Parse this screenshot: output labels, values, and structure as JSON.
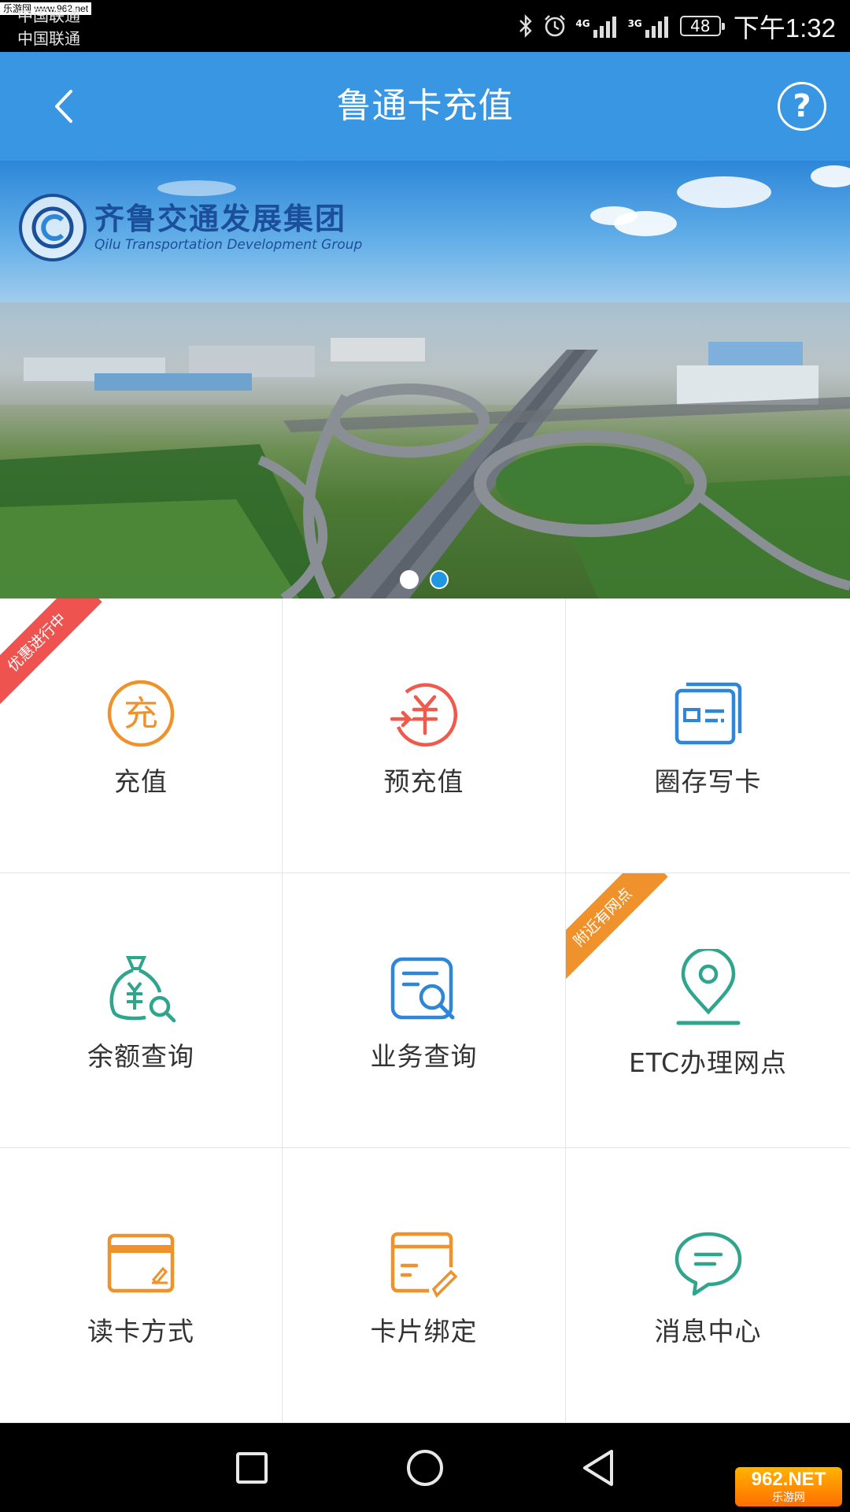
{
  "status_bar": {
    "watermark_top": "乐游网 www.962.net",
    "carrier_1": "中国联通",
    "carrier_2": "中国联通",
    "net_1": "4G",
    "net_2": "3G",
    "battery": "48",
    "time": "下午1:32"
  },
  "app_bar": {
    "title": "鲁通卡充值",
    "help_label": "?"
  },
  "banner": {
    "logo_cn": "齐鲁交通发展集团",
    "logo_en": "Qilu Transportation Development Group",
    "page_count": 2,
    "active_page": 2
  },
  "grid": [
    {
      "label": "充值",
      "icon": "recharge-icon",
      "color": "#f0922b",
      "ribbon": "优惠进行中",
      "ribbon_color": "#ef5350"
    },
    {
      "label": "预充值",
      "icon": "prepaid-icon",
      "color": "#ef5a4c"
    },
    {
      "label": "圈存写卡",
      "icon": "card-write-icon",
      "color": "#2f86d6"
    },
    {
      "label": "余额查询",
      "icon": "balance-query-icon",
      "color": "#2ea58c"
    },
    {
      "label": "业务查询",
      "icon": "business-query-icon",
      "color": "#2f86d6"
    },
    {
      "label": "ETC办理网点",
      "icon": "location-pin-icon",
      "color": "#2ea58c",
      "ribbon": "附近有网点",
      "ribbon_color": "#f0922b"
    },
    {
      "label": "读卡方式",
      "icon": "card-reader-icon",
      "color": "#f0922b"
    },
    {
      "label": "卡片绑定",
      "icon": "card-bind-icon",
      "color": "#f0922b"
    },
    {
      "label": "消息中心",
      "icon": "message-icon",
      "color": "#2ea58c"
    }
  ],
  "nav_bar": {
    "watermark_main": "962.NET",
    "watermark_sub": "乐游网"
  }
}
